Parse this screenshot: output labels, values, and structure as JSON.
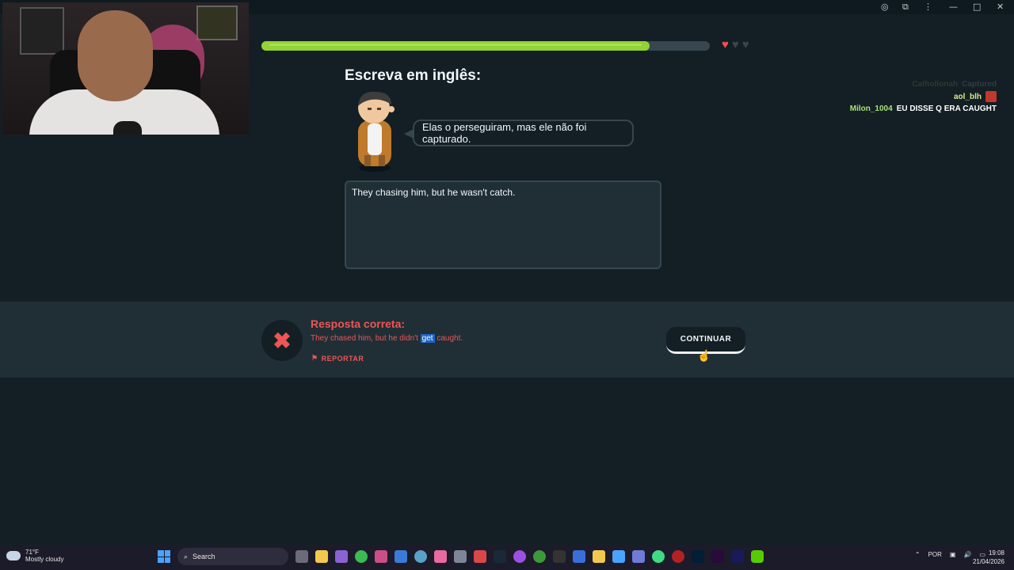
{
  "window": {
    "controls": [
      "—",
      "□",
      "✕"
    ]
  },
  "progress": {
    "fraction": 0.865
  },
  "hearts": {
    "total": 3,
    "filled": 1,
    "filled_color": "#ff4b4b",
    "empty_color": "#37464f"
  },
  "lesson": {
    "title": "Escreva em inglês:",
    "prompt_sentence": "Elas o perseguiram, mas ele não foi capturado.",
    "user_answer": "They chasing him, but he wasn't catch."
  },
  "feedback": {
    "title": "Resposta correta:",
    "answer_before": "They chased him, but he didn't ",
    "answer_highlight": "get",
    "answer_after": " caught.",
    "report_label": "REPORTAR",
    "continue_label": "CONTINUAR",
    "error_color": "#ee5555"
  },
  "chat": {
    "faded_user": "Cathollonah",
    "faded_msg": "Captured",
    "messages": [
      {
        "user": "aol_blh",
        "text": ""
      },
      {
        "user": "Milon_1004",
        "text": "EU DISSE Q ERA CAUGHT"
      }
    ]
  },
  "taskbar": {
    "weather_temp": "71°F",
    "weather_desc": "Mostly cloudy",
    "search_placeholder": "Search",
    "language": "POR",
    "time": "19:08",
    "date": "21/04/2026"
  }
}
